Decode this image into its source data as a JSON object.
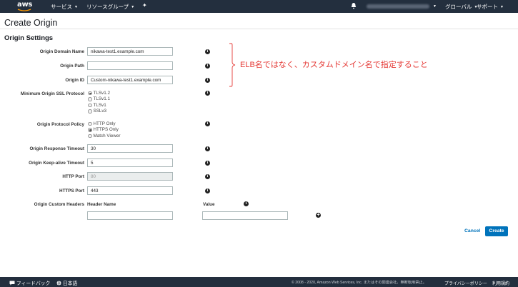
{
  "nav": {
    "services": "サービス",
    "resource_groups": "リソースグループ",
    "global": "グローバル",
    "support": "サポート"
  },
  "page": {
    "title": "Create Origin",
    "section": "Origin Settings"
  },
  "form": {
    "domain_label": "Origin Domain Name",
    "domain_value": "nikawa-test1.example.com",
    "path_label": "Origin Path",
    "path_value": "",
    "id_label": "Origin ID",
    "id_value": "Custom-nikawa-test1.example.com",
    "ssl_label": "Minimum Origin SSL Protocol",
    "ssl_options": [
      "TLSv1.2",
      "TLSv1.1",
      "TLSv1",
      "SSLv3"
    ],
    "ssl_selected": "TLSv1.2",
    "protocol_label": "Origin Protocol Policy",
    "protocol_options": [
      "HTTP Only",
      "HTTPS Only",
      "Match Viewer"
    ],
    "protocol_selected": "HTTPS Only",
    "response_timeout_label": "Origin Response Timeout",
    "response_timeout_value": "30",
    "keepalive_label": "Origin Keep-alive Timeout",
    "keepalive_value": "5",
    "http_port_label": "HTTP Port",
    "http_port_value": "80",
    "https_port_label": "HTTPS Port",
    "https_port_value": "443",
    "custom_headers_label": "Origin Custom Headers",
    "header_name_col": "Header Name",
    "value_col": "Value"
  },
  "annotation": "ELB名ではなく、カスタムドメイン名で指定すること",
  "actions": {
    "cancel": "Cancel",
    "create": "Create"
  },
  "footer": {
    "feedback": "フィードバック",
    "language": "日本語",
    "copyright": "© 2008 - 2020, Amazon Web Services, Inc. またはその関連会社。無断転用禁止。",
    "privacy": "プライバシーポリシー",
    "terms": "利用規約"
  },
  "colors": {
    "nav_bg": "#232f3e",
    "accent": "#0073bb",
    "annotation": "#e53935"
  }
}
